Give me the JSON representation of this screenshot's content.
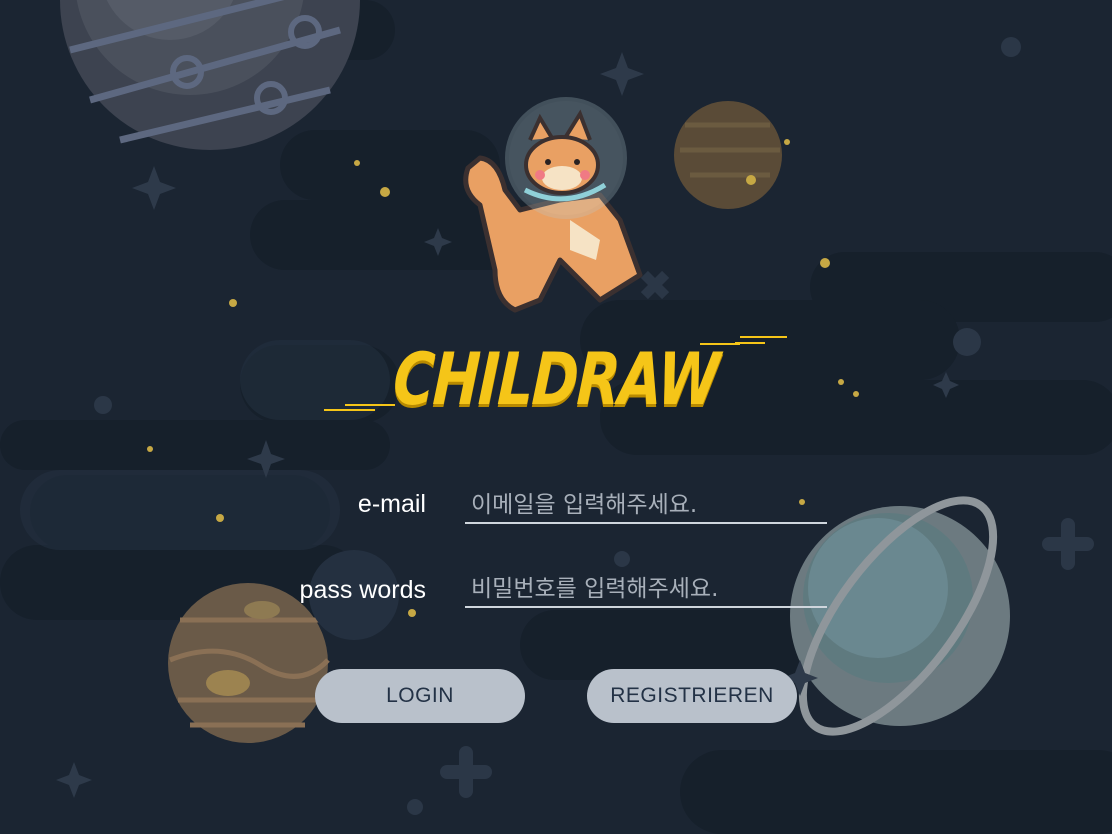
{
  "app": {
    "title": "CHILDRAW"
  },
  "login_form": {
    "email_label": "e-mail",
    "email_placeholder": "이메일을 입력해주세요.",
    "password_label": "pass words",
    "password_placeholder": "비밀번호를 입력해주세요."
  },
  "buttons": {
    "login_label": "LOGIN",
    "register_label": "REGISTRIEREN"
  },
  "colors": {
    "background": "#1b2532",
    "logo": "#f5c518",
    "button": "#b9c1cb",
    "button_text": "#233246"
  },
  "icons": [
    "shiba-astronaut-icon",
    "planet-icon",
    "saturn-icon",
    "star-icon",
    "sparkle-icon"
  ]
}
